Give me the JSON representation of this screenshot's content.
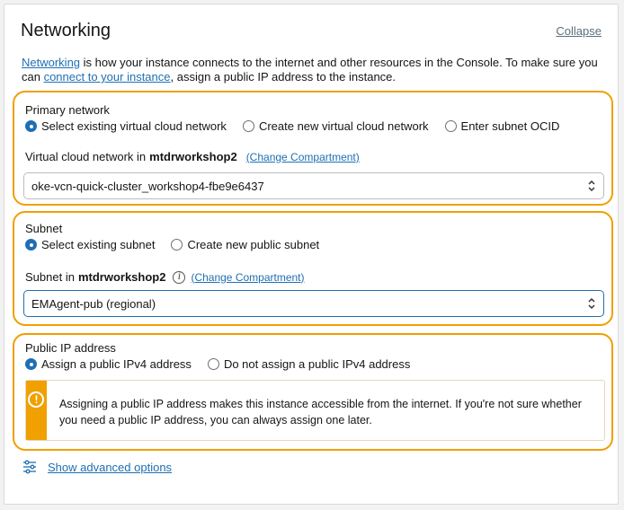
{
  "header": {
    "title": "Networking",
    "collapse_label": "Collapse"
  },
  "intro": {
    "networking_link": "Networking",
    "text_part1": " is how your instance connects to the internet and other resources in the Console. To make sure you can ",
    "connect_link": "connect to your instance",
    "text_part2": ", assign a public IP address to the instance."
  },
  "primary_network": {
    "label": "Primary network",
    "options": [
      {
        "label": "Select existing virtual cloud network",
        "selected": true
      },
      {
        "label": "Create new virtual cloud network",
        "selected": false
      },
      {
        "label": "Enter subnet OCID",
        "selected": false
      }
    ],
    "vcn_label": "Virtual cloud network in",
    "compartment": "mtdrworkshop2",
    "change_compartment": "(Change Compartment)",
    "vcn_value": "oke-vcn-quick-cluster_workshop4-fbe9e6437"
  },
  "subnet": {
    "label": "Subnet",
    "options": [
      {
        "label": "Select existing subnet",
        "selected": true
      },
      {
        "label": "Create new public subnet",
        "selected": false
      }
    ],
    "subnet_label": "Subnet in",
    "compartment": "mtdrworkshop2",
    "change_compartment": "(Change Compartment)",
    "subnet_value": "EMAgent-pub (regional)"
  },
  "public_ip": {
    "label": "Public IP address",
    "options": [
      {
        "label": "Assign a public IPv4 address",
        "selected": true
      },
      {
        "label": "Do not assign a public IPv4 address",
        "selected": false
      }
    ],
    "alert_text": "Assigning a public IP address makes this instance accessible from the internet. If you're not sure whether you need a public IP address, you can always assign one later."
  },
  "advanced": {
    "label": "Show advanced options",
    "icon": "sliders-icon"
  },
  "colors": {
    "accent": "#1f6fb2",
    "highlight": "#f0a000"
  }
}
